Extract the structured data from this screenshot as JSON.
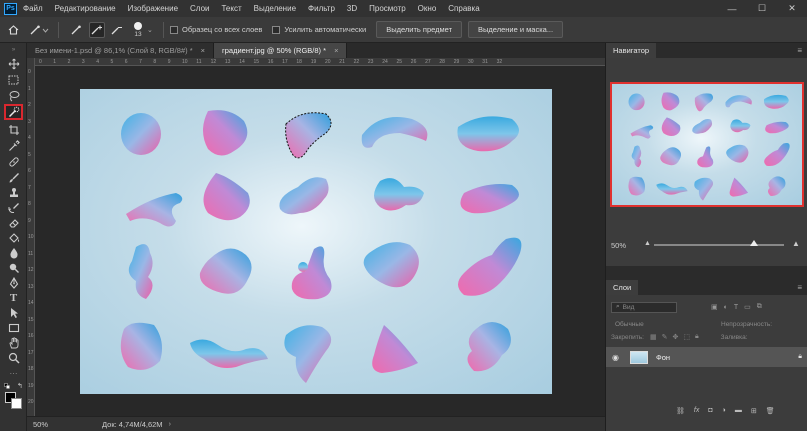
{
  "app": {
    "logo": "Ps"
  },
  "menu": [
    "Файл",
    "Редактирование",
    "Изображение",
    "Слои",
    "Текст",
    "Выделение",
    "Фильтр",
    "3D",
    "Просмотр",
    "Окно",
    "Справка"
  ],
  "window_controls": {
    "minimize": "—",
    "maximize": "☐",
    "close": "✕"
  },
  "options_bar": {
    "brush_size": "13",
    "sample_all_layers": "Образец со всех слоев",
    "auto_enhance": "Усилить автоматически",
    "select_subject": "Выделить предмет",
    "select_and_mask": "Выделение и маска..."
  },
  "tabs": [
    {
      "label": "Без имени-1.psd @ 86,1% (Слой 8, RGB/8#) *",
      "close": "×"
    },
    {
      "label": "градиент.jpg @ 50% (RGB/8) *",
      "close": "×"
    }
  ],
  "ruler_h": [
    "0",
    "1",
    "2",
    "3",
    "4",
    "5",
    "6",
    "7",
    "8",
    "9",
    "10",
    "11",
    "12",
    "13",
    "14",
    "15",
    "16",
    "17",
    "18",
    "19",
    "20",
    "21",
    "22",
    "23",
    "24",
    "25",
    "26",
    "27",
    "28",
    "29",
    "30",
    "31",
    "32"
  ],
  "ruler_v": [
    "0",
    "1",
    "2",
    "3",
    "4",
    "5",
    "6",
    "7",
    "8",
    "9",
    "10",
    "11",
    "12",
    "13",
    "14",
    "15",
    "16",
    "17",
    "18",
    "19",
    "20"
  ],
  "status": {
    "zoom": "50%",
    "doc": "Док: 4,74M/4,62M",
    "arrow": "›"
  },
  "navigator": {
    "title": "Навигатор",
    "zoom": "50%",
    "menu": "≡"
  },
  "layers_panel": {
    "title": "Слои",
    "menu": "≡",
    "filter_placeholder": "Вид",
    "blend_mode": "Обычные",
    "opacity_label": "Непрозрачность:",
    "lock_label": "Закрепить:",
    "fill_label": "Заливка:",
    "layer_name": "Фон"
  },
  "colors": {
    "accent_red": "#e0312f",
    "gradient_pink": "#e86aae",
    "gradient_blue": "#3aa9df"
  }
}
